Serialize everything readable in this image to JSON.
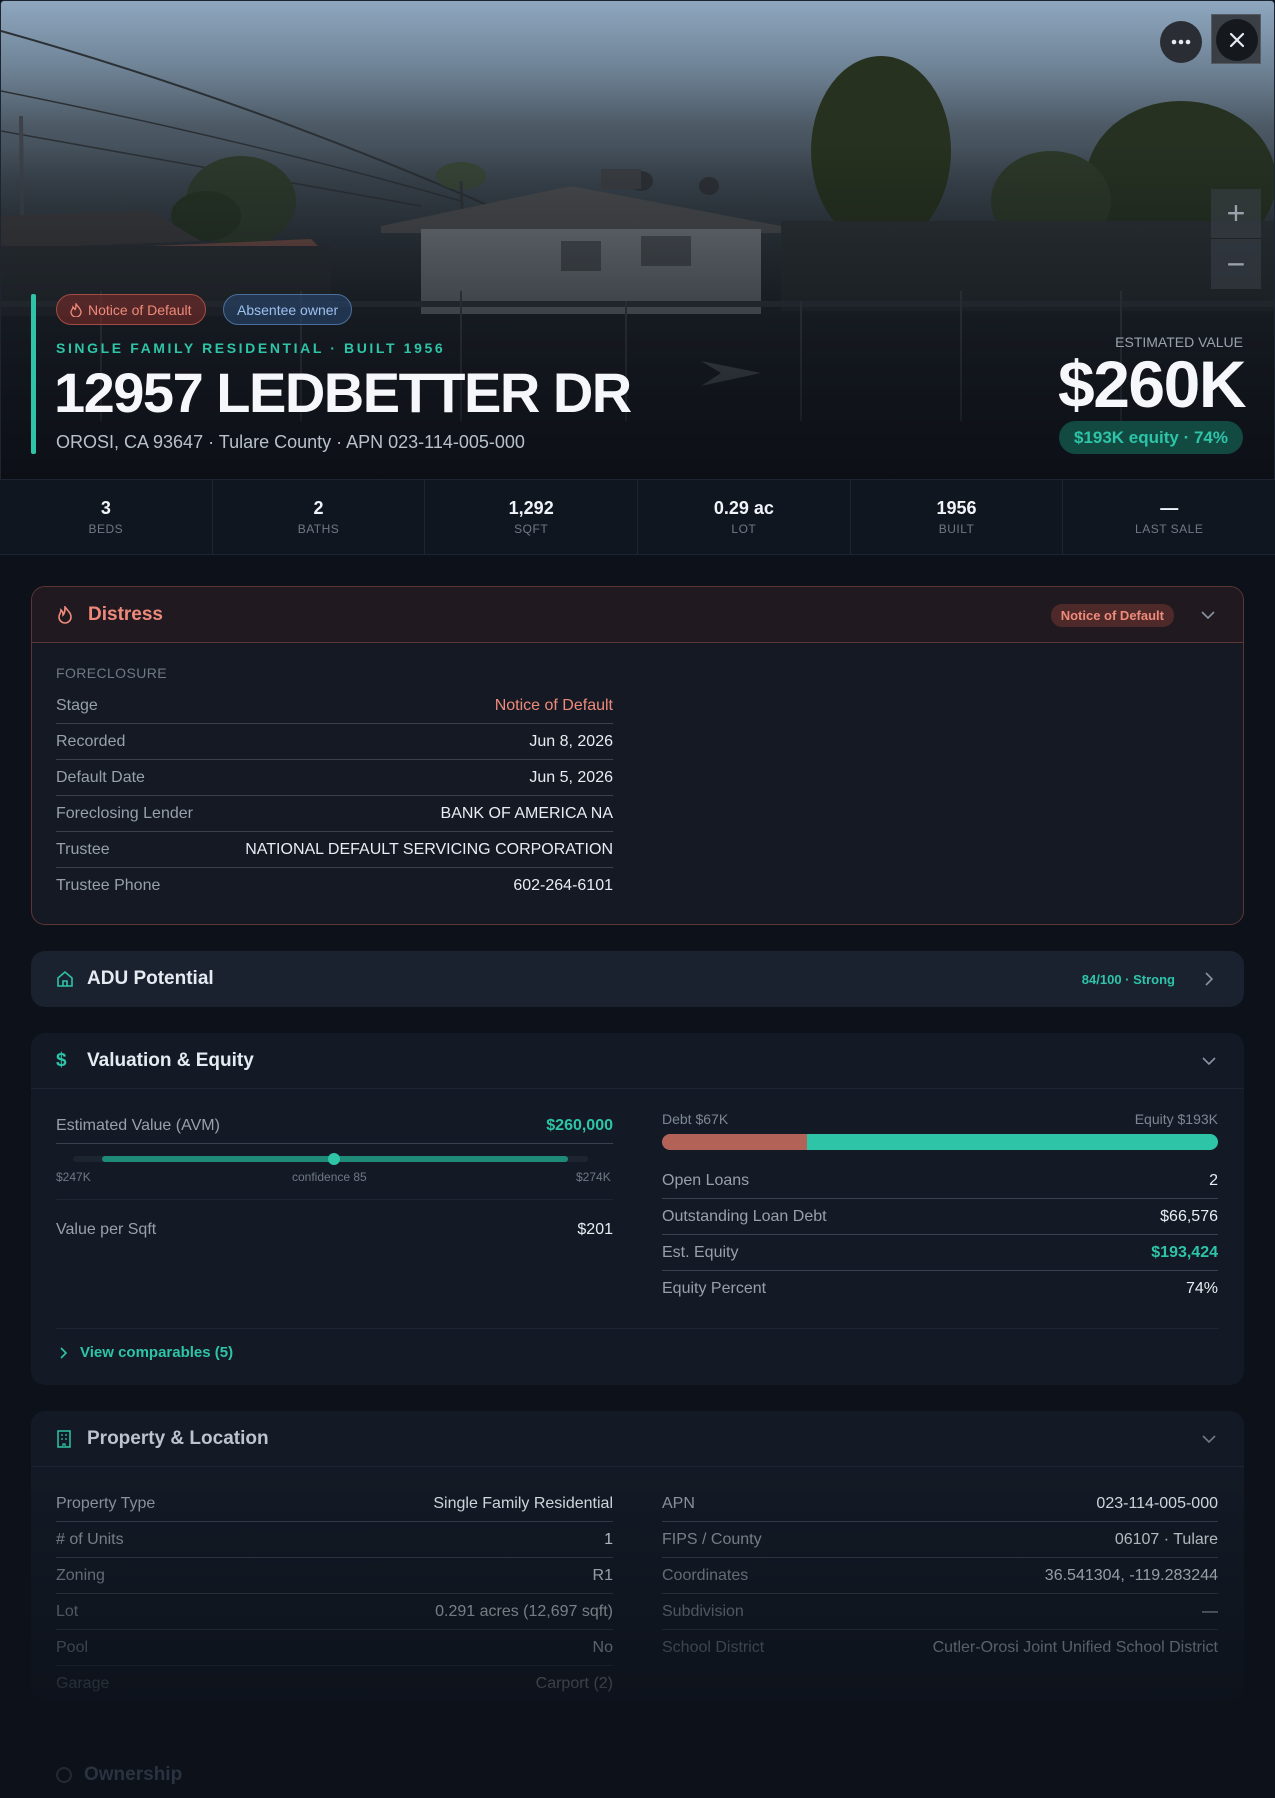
{
  "header": {
    "badges": [
      "Notice of Default",
      "Absentee owner"
    ],
    "eyebrow": "SINGLE FAMILY RESIDENTIAL · BUILT 1956",
    "address": "12957 LEDBETTER DR",
    "subaddress": "OROSI, CA 93647 · Tulare County · APN 023-114-005-000",
    "estimated_label": "ESTIMATED VALUE",
    "estimated_value": "$260K",
    "equity_pill": "$193K equity · 74%"
  },
  "stats": [
    {
      "value": "3",
      "label": "BEDS"
    },
    {
      "value": "2",
      "label": "BATHS"
    },
    {
      "value": "1,292",
      "label": "SQFT"
    },
    {
      "value": "0.29 ac",
      "label": "LOT"
    },
    {
      "value": "1956",
      "label": "BUILT"
    },
    {
      "value": "—",
      "label": "LAST SALE"
    }
  ],
  "distress": {
    "title": "Distress",
    "pill": "Notice of Default",
    "section": "FORECLOSURE",
    "rows": [
      {
        "k": "Stage",
        "v": "Notice of Default"
      },
      {
        "k": "Recorded",
        "v": "Jun 8, 2026"
      },
      {
        "k": "Default Date",
        "v": "Jun 5, 2026"
      },
      {
        "k": "Foreclosing Lender",
        "v": "BANK OF AMERICA NA"
      },
      {
        "k": "Trustee",
        "v": "NATIONAL DEFAULT SERVICING CORPORATION"
      },
      {
        "k": "Trustee Phone",
        "v": "602-264-6101"
      }
    ]
  },
  "adu": {
    "title": "ADU Potential",
    "score": "84/100 · Strong"
  },
  "valuation": {
    "title": "Valuation & Equity",
    "avm_label": "Estimated Value (AVM)",
    "avm_value": "$260,000",
    "range_low": "$247K",
    "confidence": "confidence 85",
    "range_high": "$274K",
    "per_sqft_label": "Value per Sqft",
    "per_sqft_value": "$201",
    "debt_label": "Debt $67K",
    "equity_label": "Equity $193K",
    "debt_fraction": 0.26,
    "rows": [
      {
        "k": "Open Loans",
        "v": "2"
      },
      {
        "k": "Outstanding Loan Debt",
        "v": "$66,576"
      },
      {
        "k": "Est. Equity",
        "v": "$193,424"
      },
      {
        "k": "Equity Percent",
        "v": "74%"
      }
    ],
    "comps_link": "View comparables (5)"
  },
  "property": {
    "title": "Property & Location",
    "left": [
      {
        "k": "Property Type",
        "v": "Single Family Residential"
      },
      {
        "k": "# of Units",
        "v": "1"
      },
      {
        "k": "Zoning",
        "v": "R1"
      },
      {
        "k": "Lot",
        "v": "0.291 acres (12,697 sqft)"
      },
      {
        "k": "Pool",
        "v": "No"
      },
      {
        "k": "Garage",
        "v": "Carport (2)"
      }
    ],
    "right": [
      {
        "k": "APN",
        "v": "023-114-005-000"
      },
      {
        "k": "FIPS / County",
        "v": "06107 · Tulare"
      },
      {
        "k": "Coordinates",
        "v": "36.541304, -119.283244"
      },
      {
        "k": "Subdivision",
        "v": "—"
      },
      {
        "k": "School District",
        "v": "Cutler-Orosi Joint Unified School District"
      }
    ]
  },
  "ownership": {
    "title": "Ownership"
  },
  "colors": {
    "accent": "#2ec4a8",
    "danger": "#ef8a7b",
    "background": "#0c111a"
  }
}
